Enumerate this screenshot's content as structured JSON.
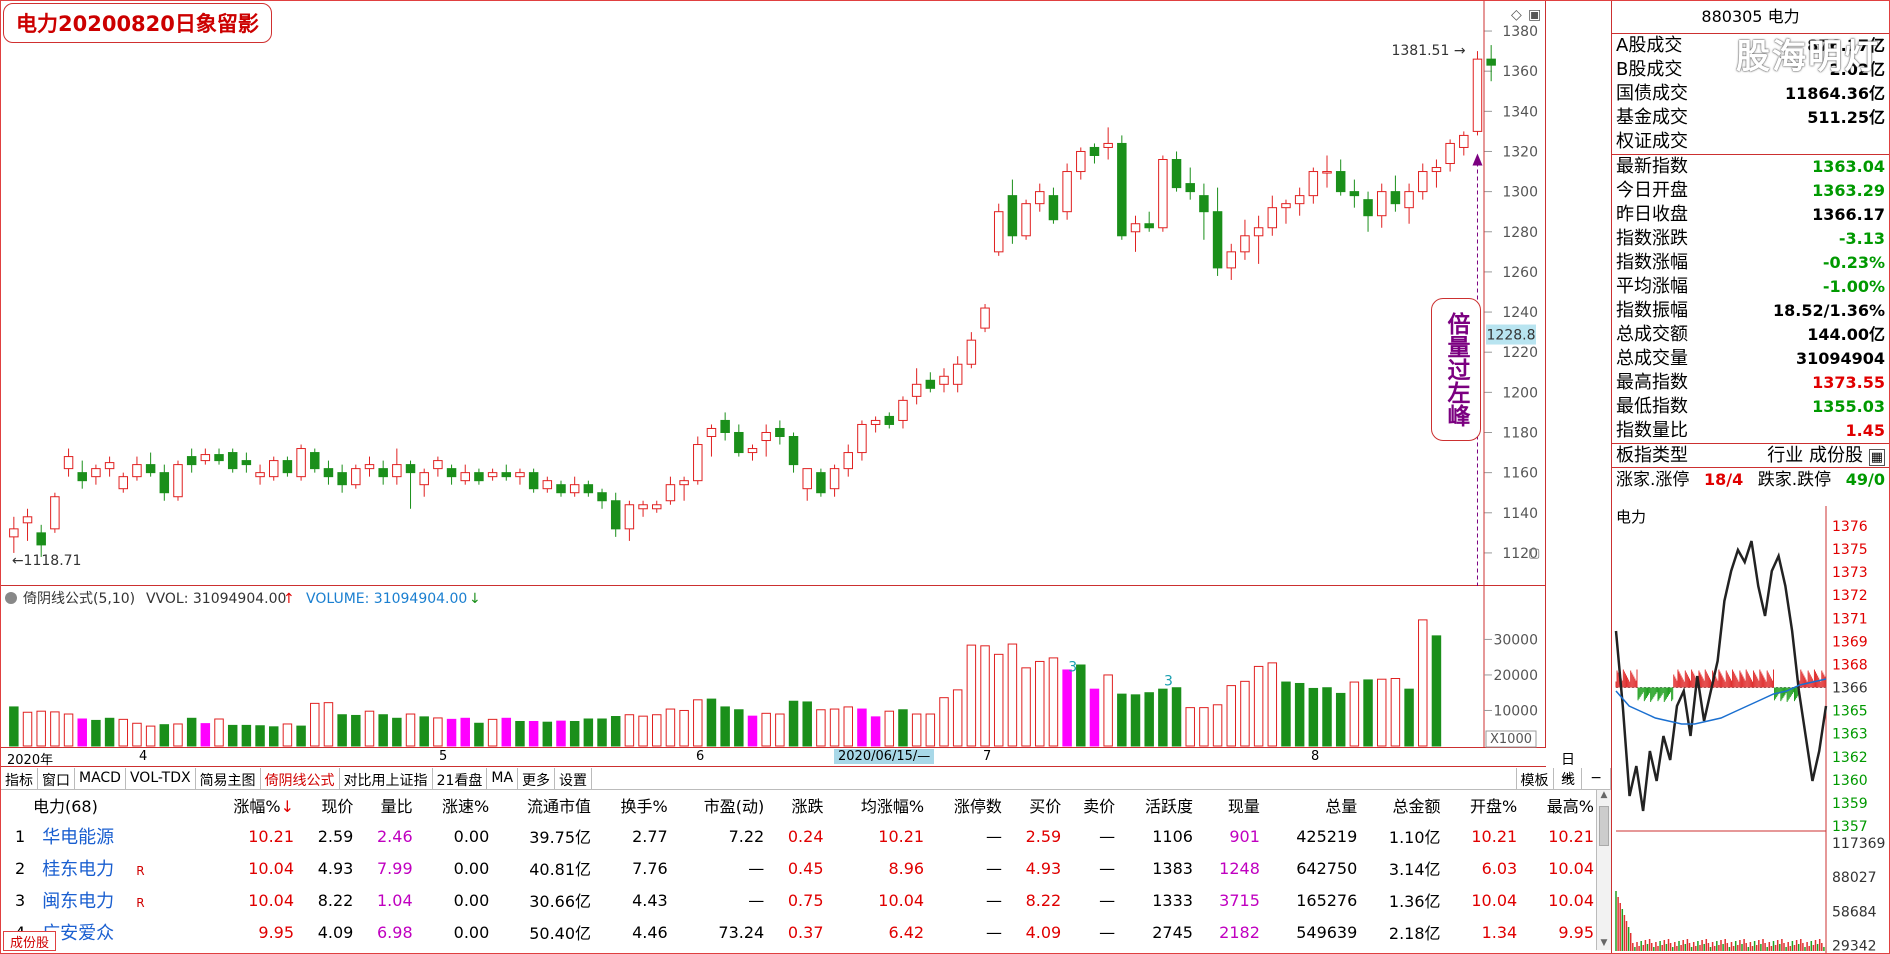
{
  "title": "电力20200820日象留影",
  "watermark": "股海明灯",
  "annotation": "倍量过左峰",
  "kline": {
    "price_axis": [
      "1380",
      "1360",
      "1340",
      "1320",
      "1300",
      "1280",
      "1260",
      "1240",
      "1220",
      "1200",
      "1180",
      "1160",
      "1140",
      "1120"
    ],
    "current_label": "1228.8",
    "high_label": "1381.51",
    "low_label": "1118.71"
  },
  "chart_data": {
    "type": "candlestick",
    "ylim": [
      1110,
      1385
    ],
    "candles": [
      [
        1128,
        1138,
        1120,
        1132
      ],
      [
        1135,
        1142,
        1126,
        1138
      ],
      [
        1130,
        1134,
        1118,
        1124
      ],
      [
        1132,
        1150,
        1130,
        1148
      ],
      [
        1162,
        1172,
        1158,
        1168
      ],
      [
        1160,
        1166,
        1152,
        1156
      ],
      [
        1158,
        1164,
        1154,
        1162
      ],
      [
        1162,
        1168,
        1158,
        1165
      ],
      [
        1152,
        1160,
        1150,
        1158
      ],
      [
        1158,
        1168,
        1156,
        1164
      ],
      [
        1164,
        1170,
        1158,
        1160
      ],
      [
        1160,
        1164,
        1146,
        1150
      ],
      [
        1148,
        1166,
        1146,
        1164
      ],
      [
        1168,
        1172,
        1160,
        1164
      ],
      [
        1166,
        1172,
        1164,
        1169
      ],
      [
        1169,
        1172,
        1164,
        1166
      ],
      [
        1170,
        1172,
        1160,
        1162
      ],
      [
        1166,
        1170,
        1160,
        1164
      ],
      [
        1158,
        1164,
        1154,
        1160
      ],
      [
        1158,
        1168,
        1156,
        1166
      ],
      [
        1166,
        1168,
        1158,
        1160
      ],
      [
        1158,
        1174,
        1156,
        1172
      ],
      [
        1170,
        1172,
        1160,
        1162
      ],
      [
        1162,
        1166,
        1154,
        1158
      ],
      [
        1160,
        1164,
        1150,
        1154
      ],
      [
        1154,
        1164,
        1152,
        1162
      ],
      [
        1162,
        1168,
        1158,
        1164
      ],
      [
        1162,
        1166,
        1154,
        1158
      ],
      [
        1158,
        1172,
        1154,
        1164
      ],
      [
        1164,
        1166,
        1142,
        1160
      ],
      [
        1154,
        1162,
        1148,
        1160
      ],
      [
        1162,
        1168,
        1158,
        1166
      ],
      [
        1162,
        1164,
        1154,
        1158
      ],
      [
        1156,
        1164,
        1154,
        1160
      ],
      [
        1160,
        1162,
        1154,
        1156
      ],
      [
        1158,
        1162,
        1156,
        1160
      ],
      [
        1160,
        1164,
        1156,
        1158
      ],
      [
        1158,
        1162,
        1154,
        1160
      ],
      [
        1160,
        1162,
        1150,
        1152
      ],
      [
        1152,
        1158,
        1150,
        1156
      ],
      [
        1154,
        1156,
        1148,
        1150
      ],
      [
        1150,
        1158,
        1148,
        1154
      ],
      [
        1154,
        1156,
        1148,
        1150
      ],
      [
        1150,
        1152,
        1142,
        1146
      ],
      [
        1146,
        1150,
        1128,
        1132
      ],
      [
        1132,
        1146,
        1126,
        1144
      ],
      [
        1142,
        1146,
        1138,
        1144
      ],
      [
        1142,
        1146,
        1140,
        1144
      ],
      [
        1146,
        1158,
        1144,
        1154
      ],
      [
        1154,
        1158,
        1146,
        1156
      ],
      [
        1156,
        1178,
        1154,
        1174
      ],
      [
        1178,
        1184,
        1168,
        1182
      ],
      [
        1186,
        1190,
        1176,
        1180
      ],
      [
        1180,
        1184,
        1168,
        1170
      ],
      [
        1170,
        1174,
        1166,
        1172
      ],
      [
        1176,
        1184,
        1168,
        1180
      ],
      [
        1182,
        1186,
        1174,
        1178
      ],
      [
        1178,
        1180,
        1160,
        1164
      ],
      [
        1152,
        1160,
        1146,
        1162
      ],
      [
        1160,
        1162,
        1148,
        1150
      ],
      [
        1152,
        1164,
        1148,
        1162
      ],
      [
        1162,
        1174,
        1158,
        1170
      ],
      [
        1170,
        1186,
        1166,
        1184
      ],
      [
        1184,
        1188,
        1180,
        1186
      ],
      [
        1188,
        1190,
        1182,
        1184
      ],
      [
        1186,
        1198,
        1182,
        1196
      ],
      [
        1198,
        1212,
        1194,
        1204
      ],
      [
        1206,
        1210,
        1200,
        1202
      ],
      [
        1204,
        1212,
        1200,
        1208
      ],
      [
        1204,
        1218,
        1200,
        1214
      ],
      [
        1214,
        1230,
        1212,
        1226
      ],
      [
        1232,
        1244,
        1230,
        1242
      ],
      [
        1270,
        1294,
        1268,
        1290
      ],
      [
        1298,
        1306,
        1274,
        1278
      ],
      [
        1278,
        1296,
        1276,
        1294
      ],
      [
        1294,
        1304,
        1290,
        1300
      ],
      [
        1298,
        1302,
        1284,
        1286
      ],
      [
        1290,
        1314,
        1286,
        1310
      ],
      [
        1310,
        1322,
        1306,
        1320
      ],
      [
        1322,
        1324,
        1314,
        1318
      ],
      [
        1322,
        1332,
        1316,
        1324
      ],
      [
        1324,
        1328,
        1276,
        1278
      ],
      [
        1280,
        1288,
        1270,
        1284
      ],
      [
        1284,
        1290,
        1280,
        1282
      ],
      [
        1282,
        1318,
        1280,
        1316
      ],
      [
        1316,
        1320,
        1300,
        1302
      ],
      [
        1304,
        1312,
        1296,
        1300
      ],
      [
        1298,
        1304,
        1276,
        1290
      ],
      [
        1290,
        1302,
        1258,
        1262
      ],
      [
        1262,
        1274,
        1256,
        1270
      ],
      [
        1270,
        1286,
        1266,
        1278
      ],
      [
        1278,
        1288,
        1264,
        1282
      ],
      [
        1282,
        1298,
        1278,
        1292
      ],
      [
        1292,
        1296,
        1284,
        1294
      ],
      [
        1294,
        1302,
        1288,
        1298
      ],
      [
        1298,
        1312,
        1294,
        1310
      ],
      [
        1310,
        1318,
        1302,
        1310
      ],
      [
        1310,
        1316,
        1298,
        1300
      ],
      [
        1300,
        1306,
        1292,
        1298
      ],
      [
        1296,
        1300,
        1280,
        1288
      ],
      [
        1288,
        1304,
        1282,
        1300
      ],
      [
        1300,
        1308,
        1290,
        1294
      ],
      [
        1292,
        1304,
        1284,
        1300
      ],
      [
        1300,
        1314,
        1296,
        1310
      ],
      [
        1310,
        1316,
        1302,
        1312
      ],
      [
        1314,
        1326,
        1310,
        1324
      ],
      [
        1322,
        1330,
        1318,
        1328
      ],
      [
        1330,
        1370,
        1328,
        1366
      ],
      [
        1366,
        1373,
        1355,
        1363
      ]
    ],
    "volume": {
      "ylim": [
        0,
        38000
      ],
      "ticks": [
        30000,
        20000,
        10000
      ],
      "bars": [
        [
          11000,
          "g"
        ],
        [
          9500,
          "r"
        ],
        [
          9800,
          "r"
        ],
        [
          9600,
          "r"
        ],
        [
          9000,
          "r"
        ],
        [
          7600,
          "m"
        ],
        [
          7200,
          "g"
        ],
        [
          7800,
          "g"
        ],
        [
          7500,
          "r"
        ],
        [
          6400,
          "r"
        ],
        [
          5600,
          "r"
        ],
        [
          6000,
          "g"
        ],
        [
          6200,
          "r"
        ],
        [
          7800,
          "g"
        ],
        [
          6300,
          "m"
        ],
        [
          7600,
          "r"
        ],
        [
          5800,
          "g"
        ],
        [
          5800,
          "g"
        ],
        [
          5700,
          "g"
        ],
        [
          5400,
          "g"
        ],
        [
          6200,
          "r"
        ],
        [
          5600,
          "g"
        ],
        [
          12000,
          "r"
        ],
        [
          12200,
          "r"
        ],
        [
          8800,
          "g"
        ],
        [
          8600,
          "g"
        ],
        [
          9800,
          "r"
        ],
        [
          8800,
          "g"
        ],
        [
          7800,
          "g"
        ],
        [
          9000,
          "r"
        ],
        [
          8200,
          "g"
        ],
        [
          7900,
          "r"
        ],
        [
          7500,
          "m"
        ],
        [
          7800,
          "m"
        ],
        [
          6400,
          "g"
        ],
        [
          7500,
          "r"
        ],
        [
          7800,
          "m"
        ],
        [
          6900,
          "g"
        ],
        [
          6900,
          "m"
        ],
        [
          6700,
          "g"
        ],
        [
          7000,
          "m"
        ],
        [
          6900,
          "g"
        ],
        [
          7600,
          "g"
        ],
        [
          7600,
          "g"
        ],
        [
          8300,
          "g"
        ],
        [
          8800,
          "r"
        ],
        [
          8400,
          "r"
        ],
        [
          8800,
          "r"
        ],
        [
          10400,
          "r"
        ],
        [
          10000,
          "r"
        ],
        [
          13000,
          "r"
        ],
        [
          13200,
          "g"
        ],
        [
          11000,
          "g"
        ],
        [
          10200,
          "g"
        ],
        [
          8400,
          "m"
        ],
        [
          9200,
          "r"
        ],
        [
          9000,
          "r"
        ],
        [
          12600,
          "g"
        ],
        [
          12400,
          "g"
        ],
        [
          10200,
          "r"
        ],
        [
          10400,
          "r"
        ],
        [
          11000,
          "r"
        ],
        [
          10400,
          "m"
        ],
        [
          8200,
          "m"
        ],
        [
          9800,
          "r"
        ],
        [
          10200,
          "g"
        ],
        [
          9000,
          "r"
        ],
        [
          9000,
          "r"
        ],
        [
          13600,
          "r"
        ],
        [
          15800,
          "r"
        ],
        [
          28400,
          "r"
        ],
        [
          28200,
          "r"
        ],
        [
          25800,
          "r"
        ],
        [
          28700,
          "r"
        ],
        [
          22000,
          "r"
        ],
        [
          23800,
          "r"
        ],
        [
          24800,
          "r"
        ],
        [
          21400,
          "m"
        ],
        [
          22800,
          "g"
        ],
        [
          16000,
          "m"
        ],
        [
          20000,
          "r"
        ],
        [
          14600,
          "g"
        ],
        [
          14400,
          "g"
        ],
        [
          15000,
          "g"
        ],
        [
          16000,
          "g"
        ],
        [
          16400,
          "g"
        ],
        [
          10800,
          "r"
        ],
        [
          10800,
          "r"
        ],
        [
          11600,
          "r"
        ],
        [
          17000,
          "r"
        ],
        [
          18200,
          "r"
        ],
        [
          22400,
          "r"
        ],
        [
          23400,
          "r"
        ],
        [
          18000,
          "g"
        ],
        [
          17600,
          "g"
        ],
        [
          16200,
          "g"
        ],
        [
          16400,
          "g"
        ],
        [
          14800,
          "g"
        ],
        [
          18000,
          "r"
        ],
        [
          18600,
          "g"
        ],
        [
          18800,
          "r"
        ],
        [
          19000,
          "r"
        ],
        [
          16000,
          "g"
        ],
        [
          35500,
          "r"
        ],
        [
          31000,
          "g"
        ]
      ]
    },
    "mini": {
      "price_ticks": [
        "1376",
        "1375",
        "1373",
        "1372",
        "1371",
        "1369",
        "1368",
        "1366",
        "1365",
        "1363",
        "1362",
        "1360",
        "1359",
        "1357"
      ],
      "vol_ticks": [
        "117369",
        "88027",
        "58684",
        "29342"
      ]
    }
  },
  "vol_header": {
    "label": "倚阴线公式(5,10)",
    "vvol": "VVOL: 31094904.00",
    "volume": "VOLUME: 31094904.00",
    "x_marker": "X1000",
    "mark_a": "3",
    "mark_b": "3"
  },
  "timeline": {
    "labels": [
      "2020年",
      "4",
      "5",
      "6",
      "7",
      "8"
    ],
    "highlight": "2020/06/15/—",
    "right": "日线"
  },
  "tabs": [
    "指标",
    "窗口",
    "MACD",
    "VOL-TDX",
    "简易主图",
    "倚阴线公式",
    "对比用上证指",
    "21看盘",
    "MA",
    "更多",
    "设置"
  ],
  "tabs_right": [
    "模板",
    "+",
    "−"
  ],
  "info": {
    "code": "880305 电力",
    "rows_top": [
      {
        "k": "A股成交",
        "v": "876.17亿"
      },
      {
        "k": "B股成交",
        "v": "2.02亿"
      },
      {
        "k": "国债成交",
        "v": "11864.36亿"
      },
      {
        "k": "基金成交",
        "v": "511.25亿"
      },
      {
        "k": "权证成交",
        "v": ""
      }
    ],
    "rows_main": [
      {
        "k": "最新指数",
        "v": "1363.04",
        "c": "green"
      },
      {
        "k": "今日开盘",
        "v": "1363.29",
        "c": "green"
      },
      {
        "k": "昨日收盘",
        "v": "1366.17",
        "c": "blk"
      },
      {
        "k": "指数涨跌",
        "v": "-3.13",
        "c": "green"
      },
      {
        "k": "指数涨幅",
        "v": "-0.23%",
        "c": "green"
      },
      {
        "k": "平均涨幅",
        "v": "-1.00%",
        "c": "green"
      },
      {
        "k": "指数振幅",
        "v": "18.52/1.36%",
        "c": "blk"
      },
      {
        "k": "总成交额",
        "v": "144.00亿",
        "c": "blk"
      },
      {
        "k": "总成交量",
        "v": "31094904",
        "c": "blk"
      },
      {
        "k": "最高指数",
        "v": "1373.55",
        "c": "red"
      },
      {
        "k": "最低指数",
        "v": "1355.03",
        "c": "green"
      },
      {
        "k": "指数量比",
        "v": "1.45",
        "c": "red"
      }
    ],
    "board_type": {
      "k": "板指类型",
      "v": "行业 成份股"
    },
    "updown": {
      "up_label": "涨家.涨停",
      "up_val": "18/4",
      "down_label": "跌家.跌停",
      "down_val": "49/0"
    },
    "mini_title": "电力"
  },
  "table": {
    "group_label": "电力(68)",
    "headers": [
      "涨幅%",
      "现价",
      "量比",
      "涨速%",
      "流通市值",
      "换手%",
      "市盈(动)",
      "涨跌",
      "均涨幅%",
      "涨停数",
      "买价",
      "卖价",
      "活跃度",
      "现量",
      "总量",
      "总金额",
      "开盘%",
      "最高%"
    ],
    "rows": [
      {
        "i": "1",
        "name": "华电能源",
        "flag": "",
        "vals": [
          "10.21",
          "2.59",
          "2.46",
          "0.00",
          "39.75亿",
          "2.77",
          "7.22",
          "0.24",
          "10.21",
          "—",
          "2.59",
          "—",
          "1106",
          "901",
          "425219",
          "1.10亿",
          "10.21",
          "10.21"
        ]
      },
      {
        "i": "2",
        "name": "桂东电力",
        "flag": "R",
        "vals": [
          "10.04",
          "4.93",
          "7.99",
          "0.00",
          "40.81亿",
          "7.76",
          "—",
          "0.45",
          "8.96",
          "—",
          "4.93",
          "—",
          "1383",
          "1248",
          "642750",
          "3.14亿",
          "6.03",
          "10.04"
        ]
      },
      {
        "i": "3",
        "name": "闽东电力",
        "flag": "R",
        "vals": [
          "10.04",
          "8.22",
          "1.04",
          "0.00",
          "30.66亿",
          "4.43",
          "—",
          "0.75",
          "10.04",
          "—",
          "8.22",
          "—",
          "1333",
          "3715",
          "165276",
          "1.36亿",
          "10.04",
          "10.04"
        ]
      },
      {
        "i": "4",
        "name": "广安爱众",
        "flag": "",
        "vals": [
          "9.95",
          "4.09",
          "6.98",
          "0.00",
          "50.40亿",
          "4.46",
          "73.24",
          "0.37",
          "6.42",
          "—",
          "4.09",
          "—",
          "2745",
          "2182",
          "549639",
          "2.18亿",
          "1.34",
          "9.95"
        ]
      }
    ]
  },
  "bottom_tab": "成份股"
}
